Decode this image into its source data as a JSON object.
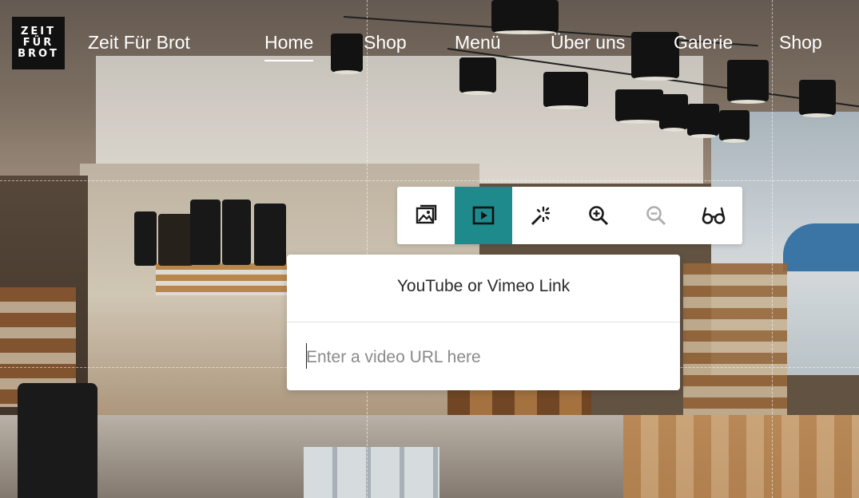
{
  "header": {
    "logo_lines": [
      "ZEIT",
      "FÜR",
      "BROT"
    ],
    "site_name": "Zeit Für Brot"
  },
  "nav": {
    "items": [
      {
        "label": "Home",
        "active": true
      },
      {
        "label": "Shop",
        "active": false
      },
      {
        "label": "Menü",
        "active": false
      },
      {
        "label": "Über uns",
        "active": false
      },
      {
        "label": "Galerie",
        "active": false
      },
      {
        "label": "Shop",
        "active": false
      }
    ]
  },
  "toolbar": {
    "accent_color": "#1f8a8c",
    "buttons": [
      {
        "icon": "image-icon",
        "active": false,
        "disabled": false
      },
      {
        "icon": "video-icon",
        "active": true,
        "disabled": false
      },
      {
        "icon": "magic-wand-icon",
        "active": false,
        "disabled": false
      },
      {
        "icon": "zoom-in-icon",
        "active": false,
        "disabled": false
      },
      {
        "icon": "zoom-out-icon",
        "active": false,
        "disabled": true
      },
      {
        "icon": "glasses-icon",
        "active": false,
        "disabled": false
      }
    ]
  },
  "video_popup": {
    "title": "YouTube or Vimeo Link",
    "input_value": "",
    "input_placeholder": "Enter a video URL here"
  }
}
